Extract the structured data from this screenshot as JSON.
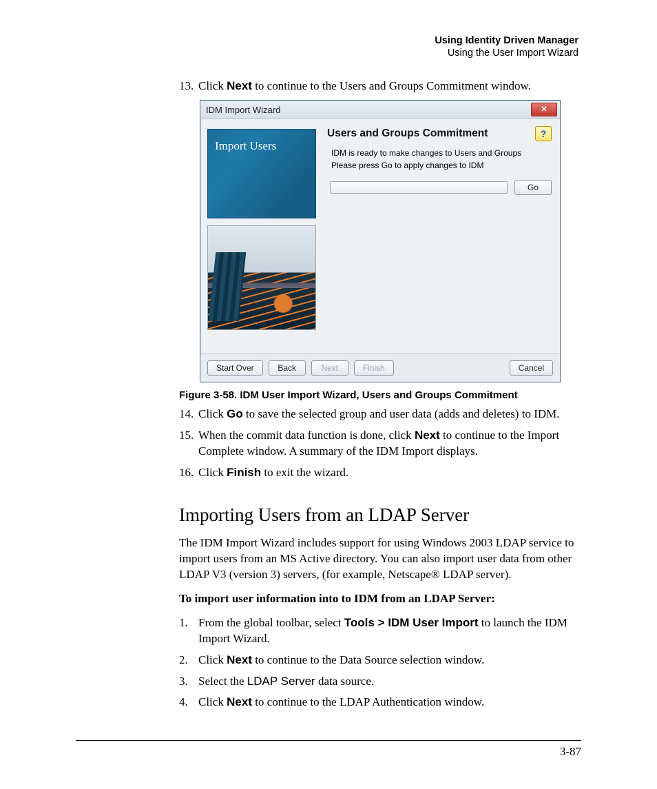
{
  "header": {
    "line1": "Using Identity Driven Manager",
    "line2": "Using the User Import Wizard"
  },
  "steps_top": {
    "s13_num": "13.",
    "s13_a": "Click ",
    "s13_b": "Next",
    "s13_c": " to continue to the Users and Groups Commitment window."
  },
  "wizard": {
    "title": "IDM Import Wizard",
    "close_glyph": "✕",
    "left_label": "Import Users",
    "heading": "Users and Groups Commitment",
    "help_glyph": "?",
    "msg1": "IDM is ready to make changes to Users and Groups",
    "msg2": "Please press Go to apply changes to IDM",
    "go": "Go",
    "start_over": "Start Over",
    "back": "Back",
    "next": "Next",
    "finish": "Finish",
    "cancel": "Cancel"
  },
  "figure_caption": "Figure 3-58. IDM User Import Wizard, Users and Groups Commitment",
  "steps_mid": {
    "s14_num": "14.",
    "s14_a": "Click ",
    "s14_b": "Go",
    "s14_c": " to save the selected group and user data (adds and deletes) to IDM.",
    "s15_num": "15.",
    "s15_a": "When the commit data function is done, click ",
    "s15_b": "Next",
    "s15_c": " to continue to the Import Complete window. A summary of the IDM Import displays.",
    "s16_num": "16.",
    "s16_a": "Click ",
    "s16_b": "Finish",
    "s16_c": " to exit the wizard."
  },
  "section_heading": "Importing Users from an LDAP Server",
  "section_intro": "The IDM Import Wizard includes support for using Windows 2003 LDAP service to import users from an MS Active directory. You can also import user data from other LDAP V3 (version 3) servers, (for example, Netscape® LDAP server).",
  "section_lead": "To import user information into to IDM from an LDAP Server:",
  "ldap_steps": {
    "l1_num": "1.",
    "l1_a": "From the global toolbar, select ",
    "l1_b": "Tools > IDM User Import",
    "l1_c": " to launch the IDM Import Wizard.",
    "l2_num": "2.",
    "l2_a": "Click ",
    "l2_b": "Next",
    "l2_c": " to continue to the Data Source selection window.",
    "l3_num": "3.",
    "l3_a": "Select the ",
    "l3_b": "LDAP Server",
    "l3_c": " data source.",
    "l4_num": "4.",
    "l4_a": "Click ",
    "l4_b": "Next",
    "l4_c": " to continue to the LDAP Authentication window."
  },
  "page_number": "3-87"
}
